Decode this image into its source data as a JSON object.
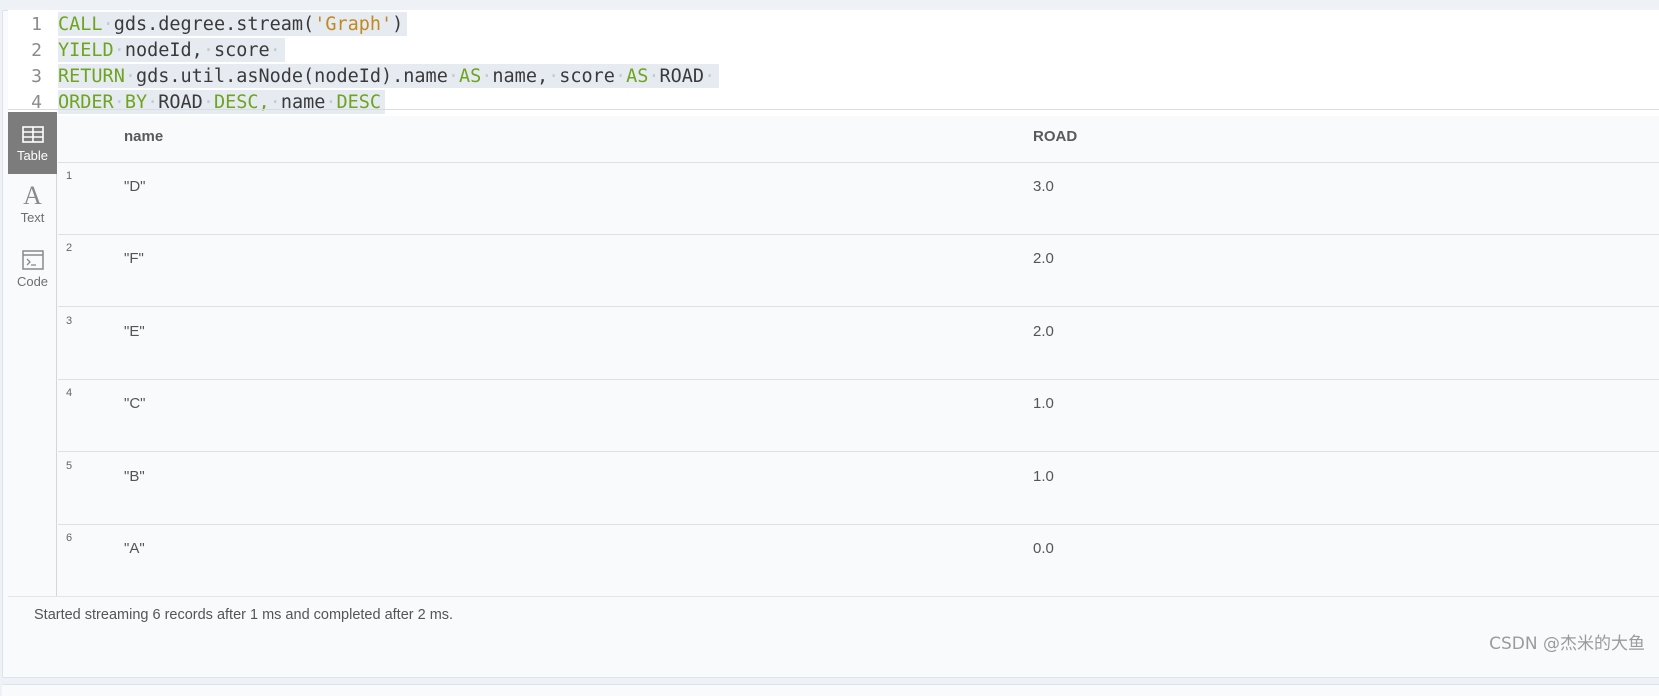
{
  "editor": {
    "lines": [
      {
        "num": "1"
      },
      {
        "num": "2"
      },
      {
        "num": "3"
      },
      {
        "num": "4"
      }
    ],
    "tokens": {
      "l1_call": "CALL",
      "l1_fn": "gds.degree.stream(",
      "l1_str": "'Graph'",
      "l1_close": ")",
      "l2_yield": "YIELD",
      "l2_node": "nodeId,",
      "l2_score": "score",
      "l3_return": "RETURN",
      "l3_expr": "gds.util.asNode(nodeId).name",
      "l3_as1": "AS",
      "l3_name": "name,",
      "l3_score": "score",
      "l3_as2": "AS",
      "l3_road": "ROAD",
      "l4_order": "ORDER",
      "l4_by": "BY",
      "l4_road": "ROAD",
      "l4_desc1": "DESC,",
      "l4_name": "name",
      "l4_desc2": "DESC",
      "dot": "·"
    }
  },
  "side_panel": {
    "items": [
      {
        "label": "Table",
        "icon": "table-icon",
        "active": true
      },
      {
        "label": "Text",
        "icon": "text-icon",
        "active": false
      },
      {
        "label": "Code",
        "icon": "code-icon",
        "active": false
      }
    ]
  },
  "table": {
    "columns": [
      "name",
      "ROAD"
    ],
    "rows": [
      {
        "num": "1",
        "name": "\"D\"",
        "road": "3.0"
      },
      {
        "num": "2",
        "name": "\"F\"",
        "road": "2.0"
      },
      {
        "num": "3",
        "name": "\"E\"",
        "road": "2.0"
      },
      {
        "num": "4",
        "name": "\"C\"",
        "road": "1.0"
      },
      {
        "num": "5",
        "name": "\"B\"",
        "road": "1.0"
      },
      {
        "num": "6",
        "name": "\"A\"",
        "road": "0.0"
      }
    ]
  },
  "status": "Started streaming 6 records after 1 ms and completed after 2 ms.",
  "watermark": "CSDN @杰米的大鱼",
  "colors": {
    "keyword": "#6ea41f",
    "string": "#c0891d",
    "active_tab": "#7c7c7c"
  }
}
